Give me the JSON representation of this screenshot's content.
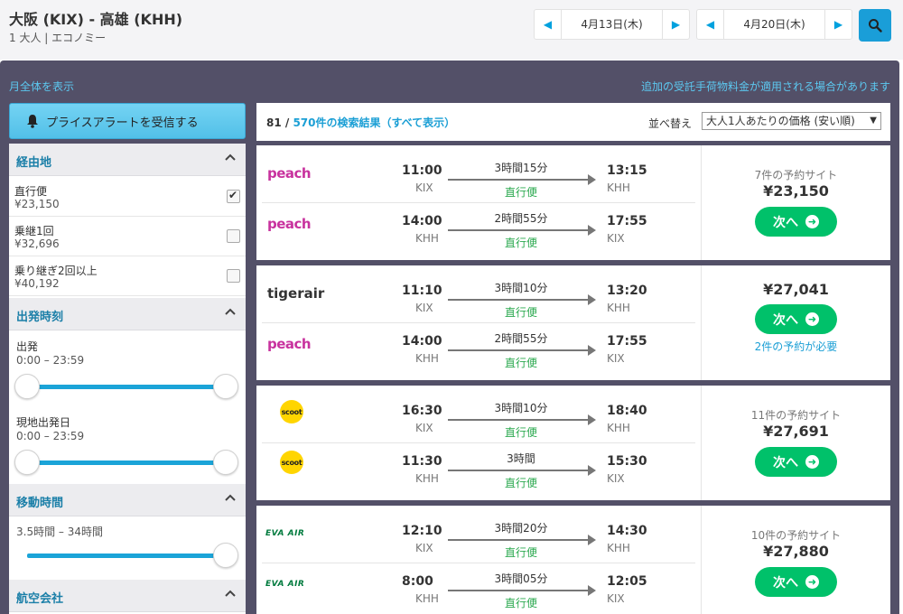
{
  "header": {
    "route": "大阪 (KIX) - 高雄 (KHH)",
    "passengers": "1 大人",
    "cabin_class": "エコノミー",
    "depart_date": "4月13日(木)",
    "return_date": "4月20日(木)"
  },
  "links": {
    "month_view": "月全体を表示",
    "baggage_notice": "追加の受託手荷物料金が適用される場合があります"
  },
  "price_alert": {
    "label": "プライスアラートを受信する"
  },
  "filters": {
    "stops": {
      "title": "経由地",
      "options": [
        {
          "label": "直行便",
          "price": "¥23,150",
          "checked": true
        },
        {
          "label": "乗継1回",
          "price": "¥32,696",
          "checked": false
        },
        {
          "label": "乗り継ぎ2回以上",
          "price": "¥40,192",
          "checked": false
        }
      ]
    },
    "departure_time": {
      "title": "出発時刻",
      "outbound_label": "出発",
      "outbound_range": "0:00 – 23:59",
      "return_label": "現地出発日",
      "return_range": "0:00 – 23:59"
    },
    "duration": {
      "title": "移動時間",
      "range": "3.5時間 – 34時間"
    },
    "airlines": {
      "title": "航空会社"
    }
  },
  "results": {
    "shown": "81",
    "separator": " / ",
    "total_link": "570件の検索結果（すべて表示）",
    "sort_label": "並べ替え",
    "sort_value": "大人1人あたりの価格 (安い順)",
    "next_label": "次へ"
  },
  "cards": [
    {
      "legs": [
        {
          "airline": "peach",
          "dep_time": "11:00",
          "dep_code": "KIX",
          "duration": "3時間15分",
          "stops": "直行便",
          "arr_time": "13:15",
          "arr_code": "KHH"
        },
        {
          "airline": "peach",
          "dep_time": "14:00",
          "dep_code": "KHH",
          "duration": "2時間55分",
          "stops": "直行便",
          "arr_time": "17:55",
          "arr_code": "KIX"
        }
      ],
      "sites": "7件の予約サイト",
      "price": "¥23,150"
    },
    {
      "legs": [
        {
          "airline": "tigerair",
          "dep_time": "11:10",
          "dep_code": "KIX",
          "duration": "3時間10分",
          "stops": "直行便",
          "arr_time": "13:20",
          "arr_code": "KHH"
        },
        {
          "airline": "peach",
          "dep_time": "14:00",
          "dep_code": "KHH",
          "duration": "2時間55分",
          "stops": "直行便",
          "arr_time": "17:55",
          "arr_code": "KIX"
        }
      ],
      "price": "¥27,041",
      "note": "2件の予約が必要"
    },
    {
      "legs": [
        {
          "airline": "scoot",
          "dep_time": "16:30",
          "dep_code": "KIX",
          "duration": "3時間10分",
          "stops": "直行便",
          "arr_time": "18:40",
          "arr_code": "KHH"
        },
        {
          "airline": "scoot",
          "dep_time": "11:30",
          "dep_code": "KHH",
          "duration": "3時間",
          "stops": "直行便",
          "arr_time": "15:30",
          "arr_code": "KIX"
        }
      ],
      "sites": "11件の予約サイト",
      "price": "¥27,691"
    },
    {
      "legs": [
        {
          "airline": "EVA AIR",
          "dep_time": "12:10",
          "dep_code": "KIX",
          "duration": "3時間20分",
          "stops": "直行便",
          "arr_time": "14:30",
          "arr_code": "KHH"
        },
        {
          "airline": "EVA AIR",
          "dep_time": "8:00",
          "dep_code": "KHH",
          "duration": "3時間05分",
          "stops": "直行便",
          "arr_time": "12:05",
          "arr_code": "KIX"
        }
      ],
      "sites": "10件の予約サイト",
      "price": "¥27,880"
    }
  ],
  "colors": {
    "accent": "#1b9fd5",
    "panel": "#535068",
    "cta_green": "#00c16a",
    "direct_green": "#2ba94f",
    "peach_brand": "#c8329e",
    "scoot_brand": "#ffd500",
    "eva_brand": "#007a3d"
  },
  "icons": {
    "alert": "bell-icon",
    "search": "search-icon",
    "collapse": "chevron-up-icon",
    "next": "arrow-right-icon",
    "prev_date": "triangle-left-icon",
    "next_date": "triangle-right-icon"
  }
}
